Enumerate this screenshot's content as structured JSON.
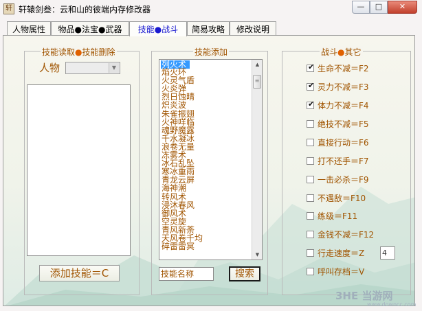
{
  "window": {
    "title": "轩辕剑叁：云和山的彼端内存修改器",
    "icon_text": "轩",
    "buttons": {
      "minimize": "—",
      "maximize": "□",
      "close": "✕"
    }
  },
  "tabs": [
    {
      "label": "人物属性"
    },
    {
      "label": "物品●法宝●武器"
    },
    {
      "label": "技能●战斗",
      "active": true
    },
    {
      "label": "简易攻略"
    },
    {
      "label": "修改说明"
    }
  ],
  "skill_read_group": {
    "label_a": "技能读取",
    "dot": "●",
    "label_b": "技能删除",
    "person_label": "人物",
    "person_value": "",
    "add_button": "添加技能＝C"
  },
  "skill_add_group": {
    "label": "技能添加",
    "skills": [
      "列火术",
      "焰火环",
      "火灵气盾",
      "火炎弹",
      "烈日蚀晴",
      "炽炎波",
      "朱雀振翅",
      "火神咩临",
      "魂野魔露",
      "千水凝冰",
      "浪卷无量",
      "冻雾术",
      "冰石乱坠",
      "寒冰重雨",
      "青龙云屏",
      "海神潮",
      "转风术",
      "浸沐春风",
      "御风术",
      "空灵旋",
      "青风新荼",
      "天风卷千均",
      "碎雷雷冥"
    ],
    "selected_index": 0,
    "search_placeholder": "技能名称",
    "search_button": "搜索"
  },
  "battle_group": {
    "label_a": "战斗",
    "dot": "●",
    "label_b": "其它",
    "options": [
      {
        "label": "生命不减＝F2",
        "checked": true
      },
      {
        "label": "灵力不减＝F3",
        "checked": true
      },
      {
        "label": "体力不减＝F4",
        "checked": true
      },
      {
        "label": "绝技不减＝F5",
        "checked": false
      },
      {
        "label": "直接行动＝F6",
        "checked": false
      },
      {
        "label": "打不还手＝F7",
        "checked": false
      },
      {
        "label": "一击必杀＝F9",
        "checked": false
      },
      {
        "label": "不遇敌＝F10",
        "checked": false
      },
      {
        "label": "练级＝F11",
        "checked": false
      },
      {
        "label": "金钱不减＝F12",
        "checked": false
      },
      {
        "label": "行走速度＝Z",
        "checked": false
      },
      {
        "label": "呼叫存档＝V",
        "checked": false
      }
    ],
    "speed_value": "4"
  },
  "watermark": {
    "text": "3HE 当游网",
    "url": "www.downcc.com"
  },
  "colors": {
    "accent": "#a05400",
    "dot": "#e06000",
    "selection": "#3399ff",
    "active_tab": "#1a1ad0"
  }
}
